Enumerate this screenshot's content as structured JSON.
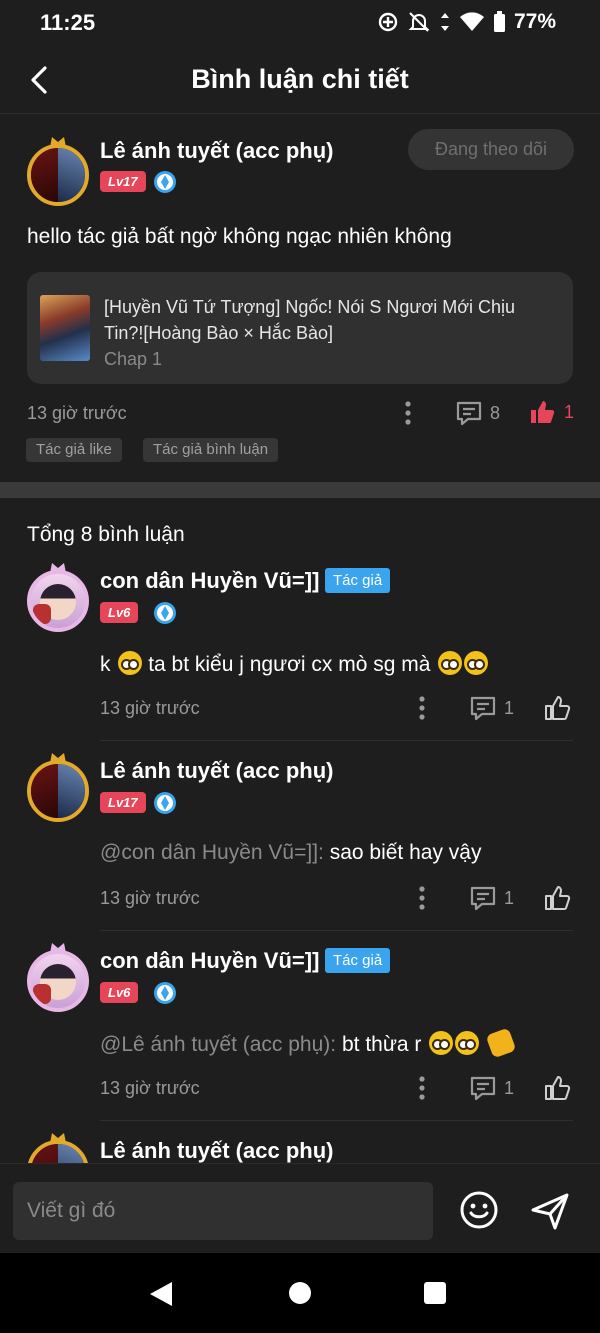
{
  "status_bar": {
    "time": "11:25",
    "battery": "77%"
  },
  "header": {
    "title": "Bình luận chi tiết"
  },
  "main_comment": {
    "username": "Lê ánh tuyết (acc phụ)",
    "level": "Lv17",
    "follow_label": "Đang theo dõi",
    "text": "hello tác giả bất ngờ không ngạc nhiên không",
    "story": {
      "title": "[Huyền Vũ Tứ Tượng] Ngốc! Nói S Ngươi Mới Chịu Tin?![Hoàng Bào × Hắc Bào]",
      "chapter": "Chap 1"
    },
    "time": "13 giờ trước",
    "comment_count": "8",
    "like_count": "1",
    "tags": [
      "Tác giả like",
      "Tác giả bình luận"
    ]
  },
  "replies_section": {
    "total_label": "Tổng 8 bình luận",
    "replies": [
      {
        "username": "con dân Huyền Vũ=]]",
        "author_label": "Tác giả",
        "level": "Lv6",
        "mention": "",
        "text": "k",
        "text2": "ta bt kiểu j ngươi cx mò sg mà",
        "time": "13 giờ trước",
        "reply_count": "1"
      },
      {
        "username": "Lê ánh tuyết (acc phụ)",
        "level": "Lv17",
        "mention": "@con dân Huyền Vũ=]]:",
        "text": "sao biết hay vậy",
        "time": "13 giờ trước",
        "reply_count": "1"
      },
      {
        "username": "con dân Huyền Vũ=]]",
        "author_label": "Tác giả",
        "level": "Lv6",
        "mention": "@Lê ánh tuyết (acc phụ):",
        "text": "bt thừa r",
        "time": "13 giờ trước",
        "reply_count": "1"
      },
      {
        "username": "Lê ánh tuyết (acc phụ)"
      }
    ]
  },
  "input": {
    "placeholder": "Viết gì đó"
  },
  "colors": {
    "background": "#1e1e1e",
    "accent_red": "#e6455a",
    "author_blue": "#3aa4ee",
    "avatar_gold": "#e2a92b"
  }
}
